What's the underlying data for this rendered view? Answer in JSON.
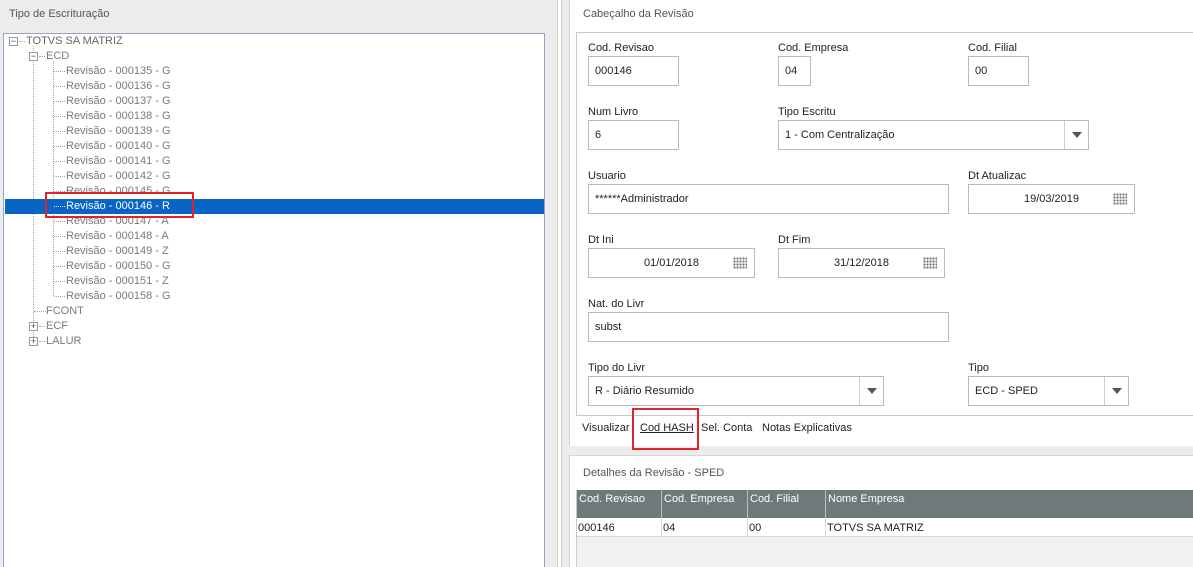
{
  "left_panel": {
    "title": "Tipo de Escrituração",
    "root": "TOTVS SA MATRIZ",
    "ecd_label": "ECD",
    "revisions": [
      "Revisão - 000135 - G",
      "Revisão - 000136 - G",
      "Revisão - 000137 - G",
      "Revisão - 000138 - G",
      "Revisão - 000139 - G",
      "Revisão - 000140 - G",
      "Revisão - 000141 - G",
      "Revisão - 000142 - G",
      "Revisão - 000145 - G",
      "Revisão - 000146 - R",
      "Revisão - 000147 - A",
      "Revisão - 000148 - A",
      "Revisão - 000149 - Z",
      "Revisão - 000150 - G",
      "Revisão - 000151 - Z",
      "Revisão - 000158 - G"
    ],
    "selected_index": 9,
    "other_nodes": [
      "FCONT",
      "ECF",
      "LALUR"
    ]
  },
  "header_panel": {
    "title": "Cabeçalho da Revisão",
    "fields": {
      "cod_revisao": {
        "label": "Cod. Revisao",
        "value": "000146"
      },
      "cod_empresa": {
        "label": "Cod. Empresa",
        "value": "04"
      },
      "cod_filial": {
        "label": "Cod. Filial",
        "value": "00"
      },
      "num_livro": {
        "label": "Num Livro",
        "value": "6"
      },
      "tipo_escritu": {
        "label": "Tipo Escritu",
        "value": "1 - Com Centralização"
      },
      "usuario": {
        "label": "Usuario",
        "value": "******Administrador"
      },
      "dt_atualizac": {
        "label": "Dt Atualizac",
        "value": "19/03/2019"
      },
      "dt_ini": {
        "label": "Dt Ini",
        "value": "01/01/2018"
      },
      "dt_fim": {
        "label": "Dt Fim",
        "value": "31/12/2018"
      },
      "nat_livr": {
        "label": "Nat. do Livr",
        "value": "subst"
      },
      "tipo_livr": {
        "label": "Tipo do Livr",
        "value": "R - Diário Resumido"
      },
      "tipo": {
        "label": "Tipo",
        "value": "ECD - SPED"
      }
    },
    "actions": [
      "Visualizar",
      "Cod HASH",
      "Sel. Conta",
      "Notas Explicativas"
    ]
  },
  "details_panel": {
    "title": "Detalhes da Revisão - SPED",
    "columns": [
      "Cod. Revisao",
      "Cod. Empresa",
      "Cod. Filial",
      "Nome Empresa"
    ],
    "rows": [
      [
        "000146",
        "04",
        "00",
        "TOTVS SA MATRIZ"
      ]
    ]
  },
  "colors": {
    "selection": "#0a64c6",
    "highlight_box": "#e0242b",
    "grid_header": "#6f7979"
  }
}
